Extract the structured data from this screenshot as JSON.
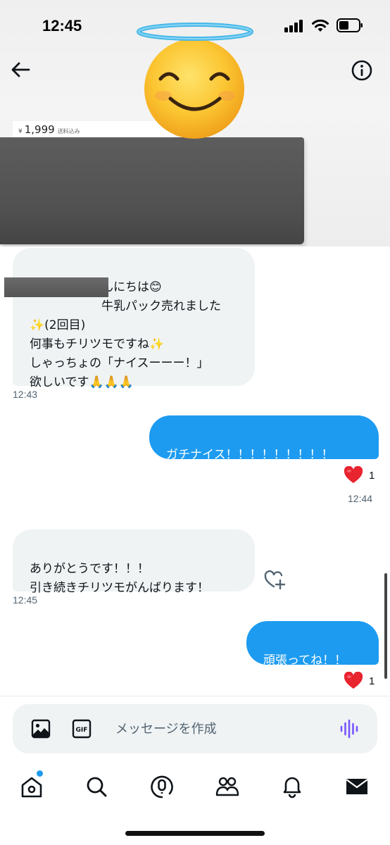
{
  "status_bar": {
    "time": "12:45"
  },
  "product": {
    "currency": "¥",
    "price": "1,999",
    "shipping": "送料込み"
  },
  "messages": [
    {
      "direction": "incoming",
      "text": "しゃっちょこんにちは😊\n　　　　　　牛乳パック売れました\n✨(2回目)\n何事もチリツモですね✨\nしゃっちょの「ナイスーーー！」\n欲しいです🙏🙏🙏",
      "time": "12:43"
    },
    {
      "direction": "outgoing",
      "text": "ガチナイス！！！！！！！！！",
      "reaction": {
        "emoji": "❤️",
        "count": "1"
      },
      "time": "12:44"
    },
    {
      "direction": "incoming",
      "text": "ありがとうです！！！\n引き続きチリツモがんばります！",
      "time": "12:45"
    },
    {
      "direction": "outgoing",
      "text": "頑張ってね！！",
      "reaction": {
        "emoji": "❤️",
        "count": "1"
      }
    }
  ],
  "composer": {
    "placeholder": "メッセージを作成",
    "gif_label": "GIF"
  },
  "colors": {
    "accent": "#1d9bf0",
    "incoming_bubble": "#eff3f4",
    "heart": "#f4212e"
  },
  "icons": {
    "header": [
      "back-arrow-icon",
      "info-icon"
    ],
    "composer": [
      "image-icon",
      "gif-icon",
      "voice-icon"
    ],
    "nav": [
      "home-icon",
      "search-icon",
      "spaces-icon",
      "communities-icon",
      "notifications-icon",
      "messages-icon"
    ]
  }
}
